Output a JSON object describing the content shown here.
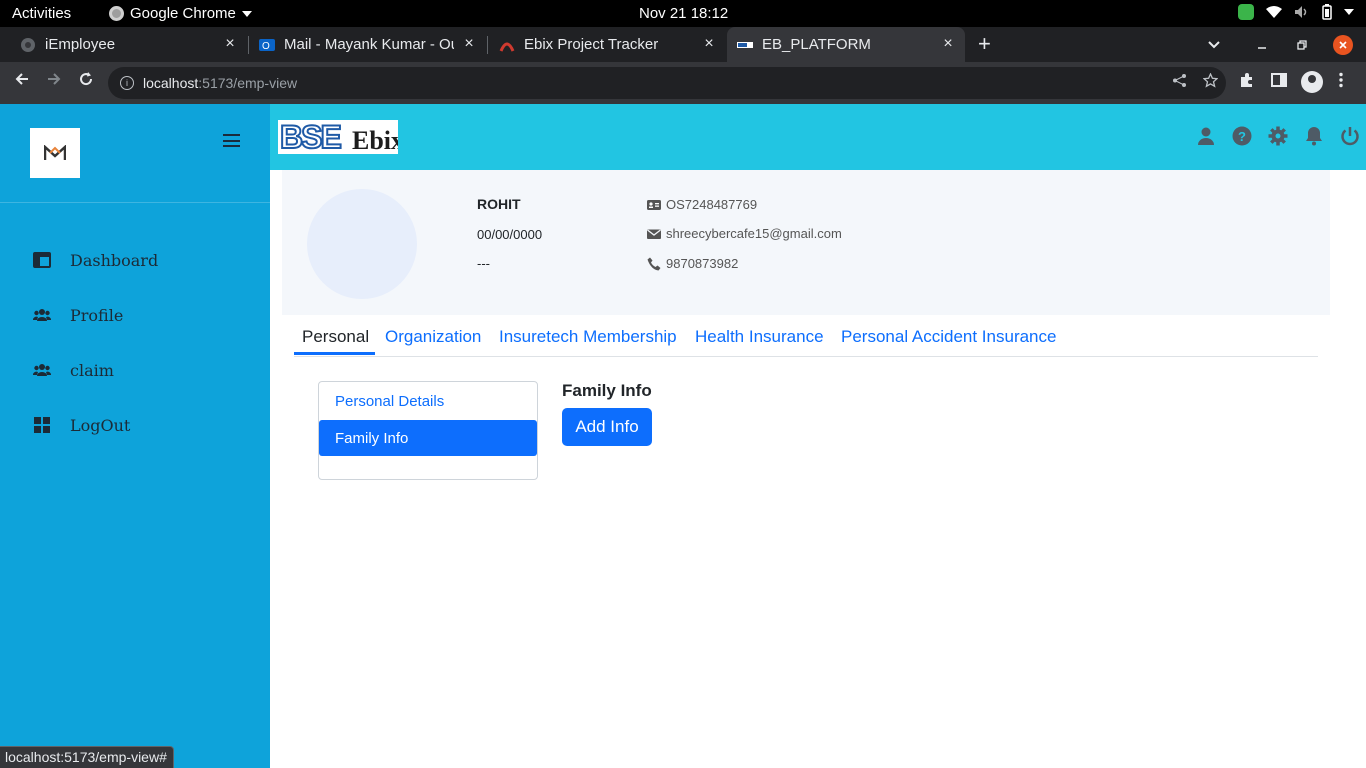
{
  "os_bar": {
    "activities": "Activities",
    "app_name": "Google Chrome",
    "clock": "Nov 21  18:12"
  },
  "browser": {
    "tabs": [
      {
        "title": "iEmployee",
        "close": "×"
      },
      {
        "title": "Mail - Mayank Kumar - Ou",
        "close": "×"
      },
      {
        "title": "Ebix Project Tracker",
        "close": "×"
      },
      {
        "title": "EB_PLATFORM",
        "close": "×"
      }
    ],
    "new_tab": "+",
    "url_host": "localhost",
    "url_path": ":5173/emp-view",
    "status_url": "localhost:5173/emp-view#"
  },
  "sidebar": {
    "items": [
      {
        "label": "Dashboard",
        "icon": "dashboard-icon"
      },
      {
        "label": "Profile",
        "icon": "users-icon"
      },
      {
        "label": "claim",
        "icon": "users-icon"
      },
      {
        "label": "LogOut",
        "icon": "grid-icon"
      }
    ]
  },
  "profile": {
    "name": "ROHIT",
    "dob": "00/00/0000",
    "other": "---",
    "employee_id": "OS7248487769",
    "email": "shreecybercafe15@gmail.com",
    "phone": "9870873982"
  },
  "tabs": [
    {
      "label": "Personal",
      "active": true
    },
    {
      "label": "Organization"
    },
    {
      "label": "Insuretech Membership"
    },
    {
      "label": "Health Insurance"
    },
    {
      "label": "Personal Accident Insurance"
    }
  ],
  "sub_nav": [
    {
      "label": "Personal Details"
    },
    {
      "label": "Family Info",
      "active": true
    }
  ],
  "family_info": {
    "title": "Family Info",
    "add_button": "Add Info"
  },
  "colors": {
    "sidebar": "#0ea3da",
    "header": "#22c5e2",
    "primary": "#0d6efd"
  }
}
